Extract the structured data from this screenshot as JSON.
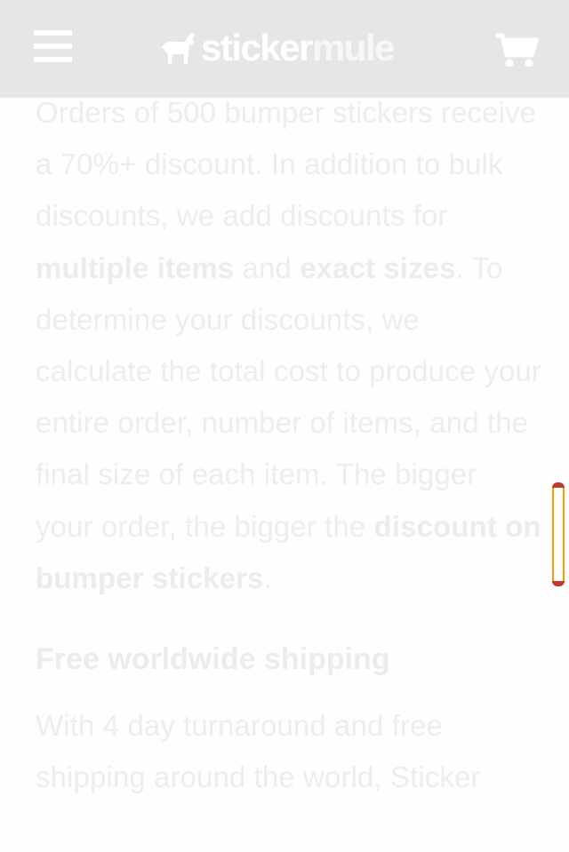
{
  "header": {
    "logo_part1": "sticker",
    "logo_part2": "mule",
    "menu_icon": "hamburger-menu-icon",
    "cart_icon": "shopping-cart-icon",
    "background_color": "#e6e6e6"
  },
  "article": {
    "para1": {
      "t1": "Orders of 500 bumper stickers receive a 70%+ discount. In addition to bulk discounts, we add discounts for ",
      "b1": "multiple items",
      "t2": " and ",
      "b2": "exact sizes",
      "t3": ". To determine your discounts, we calculate the total cost to produce your entire order, number of items, and the final size of each item. The bigger your order, the bigger the ",
      "b3": "discount on bumper stickers",
      "t4": "."
    },
    "section_title": "Free worldwide shipping",
    "para2": "With 4 day turnaround and free shipping around the world, Sticker"
  },
  "scrollbar": {
    "color": "#f4a000"
  }
}
